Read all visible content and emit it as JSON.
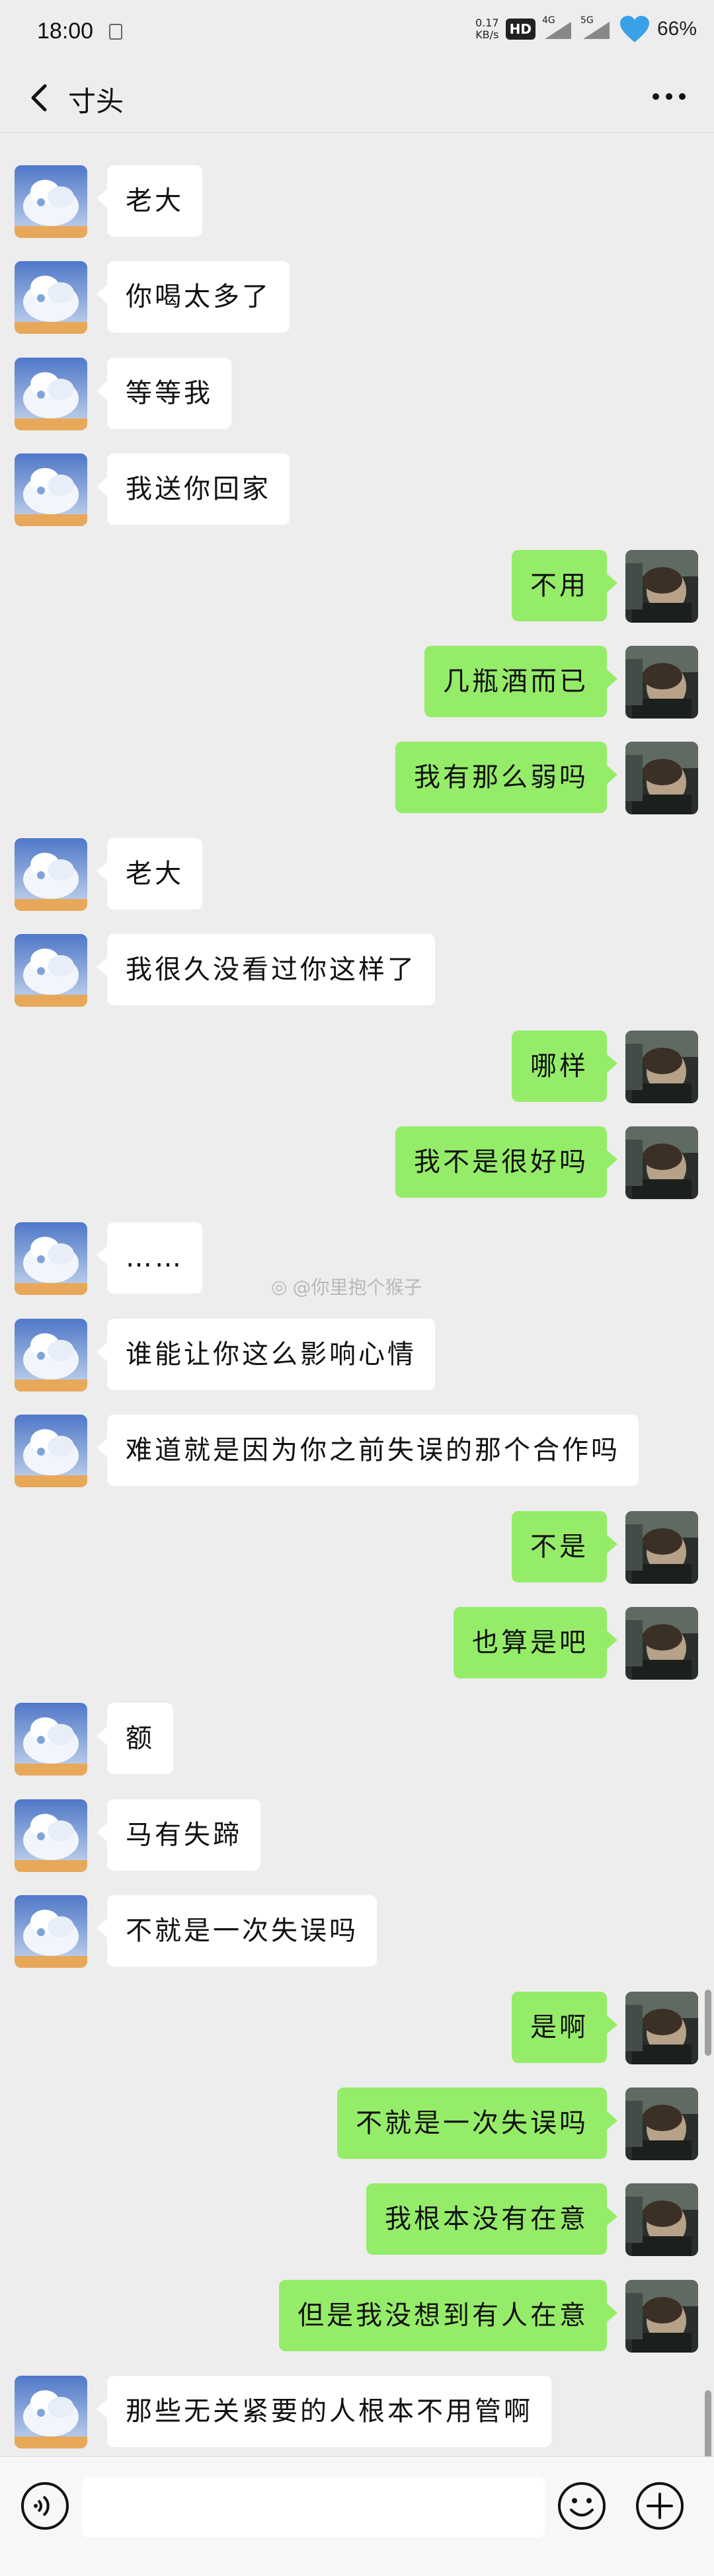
{
  "status": {
    "time": "18:00",
    "speed_value": "0.17",
    "speed_unit": "KB/s",
    "hd": "HD",
    "net1": "4G",
    "net2": "5G",
    "battery": "66%"
  },
  "header": {
    "title": "寸头"
  },
  "watermark": "@你里抱个猴子",
  "messages": [
    {
      "side": "left",
      "text": "老大"
    },
    {
      "side": "left",
      "text": "你喝太多了"
    },
    {
      "side": "left",
      "text": "等等我"
    },
    {
      "side": "left",
      "text": "我送你回家"
    },
    {
      "side": "right",
      "text": "不用"
    },
    {
      "side": "right",
      "text": "几瓶酒而已"
    },
    {
      "side": "right",
      "text": "我有那么弱吗"
    },
    {
      "side": "left",
      "text": "老大"
    },
    {
      "side": "left",
      "text": "我很久没看过你这样了"
    },
    {
      "side": "right",
      "text": "哪样"
    },
    {
      "side": "right",
      "text": "我不是很好吗"
    },
    {
      "side": "left",
      "text": "……"
    },
    {
      "side": "left",
      "text": "谁能让你这么影响心情"
    },
    {
      "side": "left",
      "text": "难道就是因为你之前失误的那个合作吗"
    },
    {
      "side": "right",
      "text": "不是"
    },
    {
      "side": "right",
      "text": "也算是吧"
    },
    {
      "side": "left",
      "text": "额"
    },
    {
      "side": "left",
      "text": "马有失蹄"
    },
    {
      "side": "left",
      "text": "不就是一次失误吗"
    },
    {
      "side": "right",
      "text": "是啊"
    },
    {
      "side": "right",
      "text": "不就是一次失误吗"
    },
    {
      "side": "right",
      "text": "我根本没有在意"
    },
    {
      "side": "right",
      "text": "但是我没想到有人在意"
    },
    {
      "side": "left",
      "text": "那些无关紧要的人根本不用管啊"
    }
  ]
}
